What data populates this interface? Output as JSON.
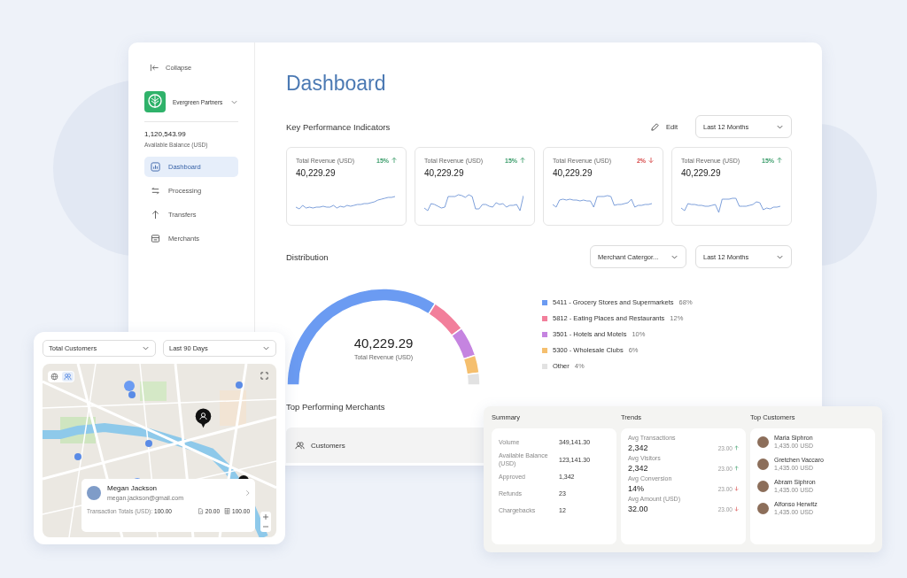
{
  "sidebar": {
    "collapse": "Collapse",
    "account": "Evergreen Partners",
    "balance": "1,120,543.99",
    "balance_label": "Available Balance (USD)",
    "items": [
      {
        "label": "Dashboard",
        "selected": true,
        "kind": "chart"
      },
      {
        "label": "Processing",
        "selected": false,
        "kind": "swap"
      },
      {
        "label": "Transfers",
        "selected": false,
        "kind": "arrow"
      },
      {
        "label": "Merchants",
        "selected": false,
        "kind": "store"
      }
    ]
  },
  "title": "Dashboard",
  "kpi": {
    "heading": "Key Performance Indicators",
    "edit": "Edit",
    "period": "Last 12 Months",
    "cards": [
      {
        "label": "Total Revenue (USD)",
        "value": "40,229.29",
        "change": "15%",
        "rising": true
      },
      {
        "label": "Total Revenue (USD)",
        "value": "40,229.29",
        "change": "15%",
        "rising": true
      },
      {
        "label": "Total Revenue (USD)",
        "value": "40,229.29",
        "change": "2%",
        "rising": false
      },
      {
        "label": "Total Revenue (USD)",
        "value": "40,229.29",
        "change": "15%",
        "rising": true
      }
    ]
  },
  "distribution": {
    "heading": "Distribution",
    "filters": [
      "Merchant Catergor...",
      "Last 12 Months"
    ],
    "center_value": "40,229.29",
    "center_label": "Total Revenue (USD)",
    "chart_data": {
      "type": "donut",
      "categories": [
        "5411 - Grocery Stores and Supermarkets",
        "5812 - Eating Places and Restaurants",
        "3501 - Hotels and Motels",
        "5300 - Wholesale Clubs",
        "Other"
      ],
      "values": [
        68,
        12,
        10,
        6,
        4
      ]
    },
    "legend": [
      {
        "percent": "68%",
        "color": "#6b9bf2"
      },
      {
        "percent": "12%",
        "color": "#f27f9b"
      },
      {
        "percent": "10%",
        "color": "#c584e0"
      },
      {
        "percent": "6%",
        "color": "#f5bf6e"
      },
      {
        "percent": "4%",
        "color": "#e2e2e2"
      }
    ]
  },
  "merchants": {
    "heading": "Top Performing Merchants",
    "tab": "Customers"
  },
  "map_card": {
    "filters": [
      "Total Customers",
      "Last 90 Days"
    ],
    "view_options": [
      {
        "kind": "globe",
        "selected": false
      },
      {
        "kind": "people",
        "selected": true
      }
    ],
    "customer": {
      "name": "Megan Jackson",
      "email": "megan.jackson@gmail.com",
      "totals_label": "Transaction Totals (USD):",
      "totals_value": "100.00",
      "stat_1": "20.00",
      "stat_2": "100.00"
    }
  },
  "summary_card": {
    "summary": {
      "heading": "Summary",
      "rows": [
        {
          "label": "Volume",
          "value": "349,141.30"
        },
        {
          "label": "Available Balance (USD)",
          "value": "123,141.30"
        },
        {
          "label": "Approved",
          "value": "1,342"
        },
        {
          "label": "Refunds",
          "value": "23"
        },
        {
          "label": "Chargebacks",
          "value": "12"
        }
      ]
    },
    "trends": {
      "heading": "Trends",
      "items": [
        {
          "label": "Avg Transactions",
          "value": "2,342",
          "change": "23.00",
          "rising": true
        },
        {
          "label": "Avg Visitors",
          "value": "2,342",
          "change": "23.00",
          "rising": true
        },
        {
          "label": "Avg Conversion",
          "value": "14%",
          "change": "23.00",
          "rising": false
        },
        {
          "label": "Avg Amount (USD)",
          "value": "32.00",
          "change": "23.00",
          "rising": false
        }
      ]
    },
    "top_customers": {
      "heading": "Top Customers",
      "items": [
        {
          "name": "Maria Siphron",
          "amount": "1,435.00 USD"
        },
        {
          "name": "Gretchen Vaccaro",
          "amount": "1,435.00 USD"
        },
        {
          "name": "Abram Siphron",
          "amount": "1,435.00 USD"
        },
        {
          "name": "Alfonso Herwitz",
          "amount": "1,435.00 USD"
        }
      ]
    }
  }
}
